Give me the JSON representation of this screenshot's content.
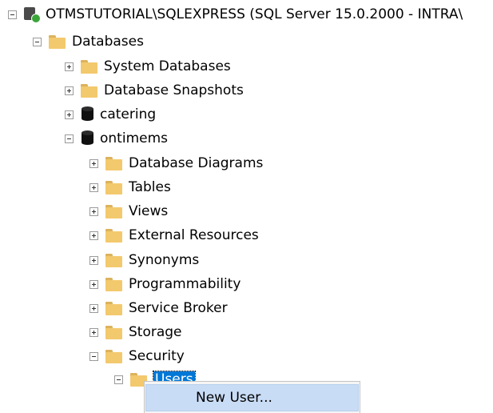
{
  "tree": {
    "server": {
      "label": "OTMSTUTORIAL\\SQLEXPRESS (SQL Server 15.0.2000 - INTRA\\",
      "expanded": true
    },
    "databases": {
      "label": "Databases",
      "expanded": true
    },
    "system_databases": {
      "label": "System Databases",
      "expanded": false
    },
    "database_snapshots": {
      "label": "Database Snapshots",
      "expanded": false
    },
    "catering": {
      "label": "catering",
      "expanded": false
    },
    "ontimems": {
      "label": "ontimems",
      "expanded": true
    },
    "ontimems_children": [
      {
        "label": "Database Diagrams",
        "expanded": false
      },
      {
        "label": "Tables",
        "expanded": false
      },
      {
        "label": "Views",
        "expanded": false
      },
      {
        "label": "External Resources",
        "expanded": false
      },
      {
        "label": "Synonyms",
        "expanded": false
      },
      {
        "label": "Programmability",
        "expanded": false
      },
      {
        "label": "Service Broker",
        "expanded": false
      },
      {
        "label": "Storage",
        "expanded": false
      },
      {
        "label": "Security",
        "expanded": true
      }
    ],
    "users": {
      "label": "Users",
      "expanded": true,
      "selected": true
    }
  },
  "context_menu": {
    "items": [
      {
        "label": "New User..."
      }
    ]
  },
  "colors": {
    "selection": "#0078d7",
    "folder": "#f3c96d",
    "menu_highlight": "#c9dcf5"
  }
}
